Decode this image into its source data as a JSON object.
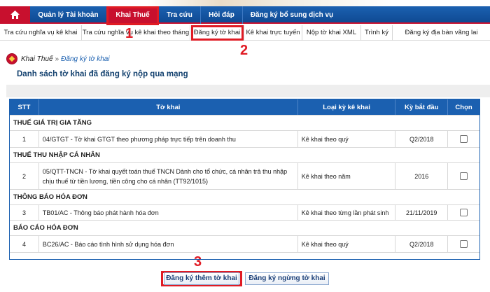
{
  "main_nav": {
    "items": [
      {
        "label": "Quản lý Tài khoản"
      },
      {
        "label": "Khai Thuế"
      },
      {
        "label": "Tra cứu"
      },
      {
        "label": "Hỏi đáp"
      },
      {
        "label": "Đăng ký bổ sung dịch vụ"
      }
    ]
  },
  "sub_nav": {
    "items": [
      {
        "label": "Tra cứu nghĩa vụ kê khai"
      },
      {
        "label": "Tra cứu nghĩa vụ kê khai theo tháng"
      },
      {
        "label": "Đăng ký tờ khai"
      },
      {
        "label": "Kê khai trực tuyến"
      },
      {
        "label": "Nộp tờ khai XML"
      },
      {
        "label": "Trình ký"
      },
      {
        "label": "Đăng ký địa bàn vãng lai"
      }
    ]
  },
  "steps": [
    "1",
    "2",
    "3"
  ],
  "breadcrumb": {
    "section": "Khai Thuế",
    "separator": "»",
    "current": "Đăng ký tờ khai"
  },
  "page_title": "Danh sách tờ khai đã đăng ký nộp qua mạng",
  "table": {
    "headers": {
      "stt": "STT",
      "form": "Tờ khai",
      "period_type": "Loại kỳ kê khai",
      "start_period": "Kỳ bắt đầu",
      "select": "Chọn"
    },
    "groups": [
      {
        "name": "THUẾ GIÁ TRỊ GIA TĂNG",
        "row": {
          "stt": "1",
          "form": "04/GTGT - Tờ khai GTGT theo phương pháp trực tiếp trên doanh thu",
          "period_type": "Kê khai theo quý",
          "start_period": "Q2/2018"
        }
      },
      {
        "name": "THUẾ THU NHẬP CÁ NHÂN",
        "row": {
          "stt": "2",
          "form": "05/QTT-TNCN - Tờ khai quyết toán thuế TNCN Dành cho tổ chức, cá nhân trả thu nhập chịu thuế từ tiền lương, tiền công cho cá nhân (TT92/1015)",
          "period_type": "Kê khai theo năm",
          "start_period": "2016"
        }
      },
      {
        "name": "THÔNG BÁO HÓA ĐƠN",
        "row": {
          "stt": "3",
          "form": "TB01/AC - Thông báo phát hành hóa đơn",
          "period_type": "Kê khai theo từng lần phát sinh",
          "start_period": "21/11/2019"
        }
      },
      {
        "name": "BÁO CÁO HÓA ĐƠN",
        "row": {
          "stt": "4",
          "form": "BC26/AC - Báo cáo tình hình sử dụng hóa đơn",
          "period_type": "Kê khai theo quý",
          "start_period": "Q2/2018"
        }
      }
    ]
  },
  "buttons": {
    "register_more": "Đăng ký thêm tờ khai",
    "register_stop": "Đăng ký ngừng tờ khai"
  },
  "colors": {
    "nav_blue": "#1b60b0",
    "brand_red": "#c8102e",
    "highlight_red": "#e01b24"
  }
}
